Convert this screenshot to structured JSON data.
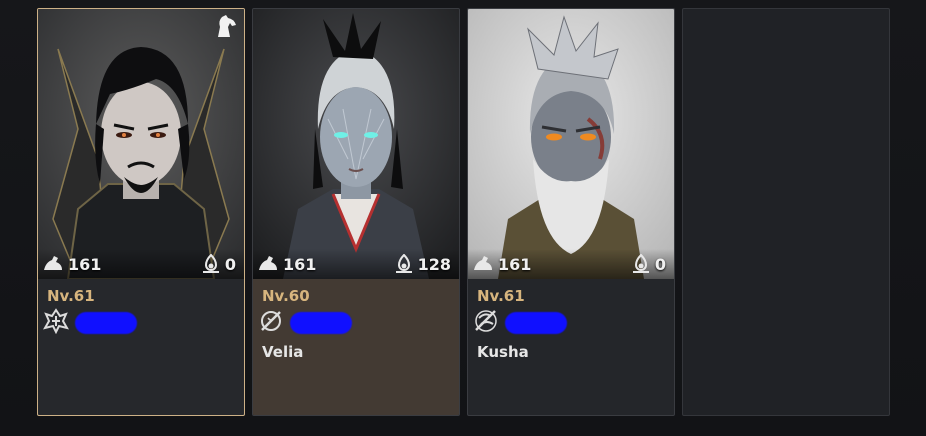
{
  "characters": [
    {
      "level": "Nv.61",
      "region": "",
      "left_stat": "161",
      "right_stat": "0",
      "name_redacted": true,
      "selected": true,
      "mount_icon": "horse-icon",
      "class_icon": "dark-knight-class-icon",
      "stat_left_icon": "arm-strength-icon",
      "stat_right_icon": "energy-flame-icon"
    },
    {
      "level": "Nv.60",
      "region": "Velia",
      "left_stat": "161",
      "right_stat": "128",
      "name_redacted": true,
      "selected": false,
      "class_icon": "sorceress-class-icon",
      "stat_left_icon": "arm-strength-icon",
      "stat_right_icon": "energy-flame-icon"
    },
    {
      "level": "Nv.61",
      "region": "Kusha",
      "left_stat": "161",
      "right_stat": "0",
      "name_redacted": true,
      "selected": false,
      "class_icon": "mystic-class-icon",
      "stat_left_icon": "arm-strength-icon",
      "stat_right_icon": "energy-flame-icon"
    }
  ],
  "empty_slot": true,
  "colors": {
    "level_gold": "#d7b57e",
    "selected_border": "#cdb187",
    "redaction_blue": "#1010ff",
    "hover_panel": "#433a33"
  }
}
